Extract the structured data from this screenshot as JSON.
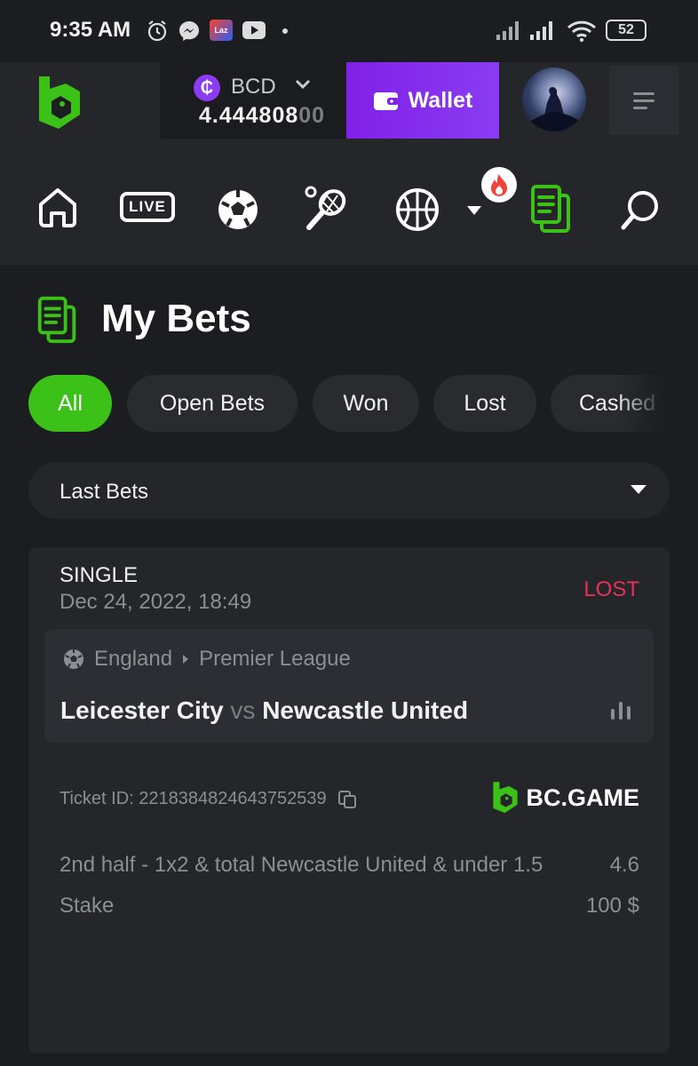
{
  "status_bar": {
    "time": "9:35 AM",
    "battery": "52",
    "icons": [
      "alarm-icon",
      "messenger-icon",
      "lazada-icon",
      "youtube-icon",
      "dot-icon",
      "signal-icon",
      "signal-icon",
      "wifi-icon",
      "battery-icon"
    ]
  },
  "header": {
    "currency": "BCD",
    "currency_symbol": "₵",
    "balance_main": "4.444808",
    "balance_dim": "00",
    "wallet_label": "Wallet"
  },
  "nav": {
    "items": [
      "home-icon",
      "live-icon",
      "soccer-icon",
      "tennis-icon",
      "basketball-icon",
      "more-caret-icon",
      "my-bets-icon",
      "search-icon"
    ],
    "live_label": "LIVE"
  },
  "page": {
    "title": "My Bets"
  },
  "tabs": [
    "All",
    "Open Bets",
    "Won",
    "Lost",
    "Cashed out"
  ],
  "filter": {
    "selected": "Last Bets"
  },
  "bet": {
    "type": "SINGLE",
    "date": "Dec 24, 2022, 18:49",
    "status": "LOST",
    "country": "England",
    "league": "Premier League",
    "home": "Leicester City",
    "vs": "vs",
    "away": "Newcastle United",
    "ticket": "Ticket ID: 2218384824643752539",
    "brand": "BC.GAME",
    "pick": "2nd half - 1x2 & total Newcastle United & under 1.5",
    "odds": "4.6",
    "stake_label": "Stake",
    "stake_value": "100 $"
  },
  "colors": {
    "accent_green": "#3bc117",
    "wallet_purple": "#8120e8",
    "lost_red": "#e8305f",
    "background": "#1c1d20"
  }
}
